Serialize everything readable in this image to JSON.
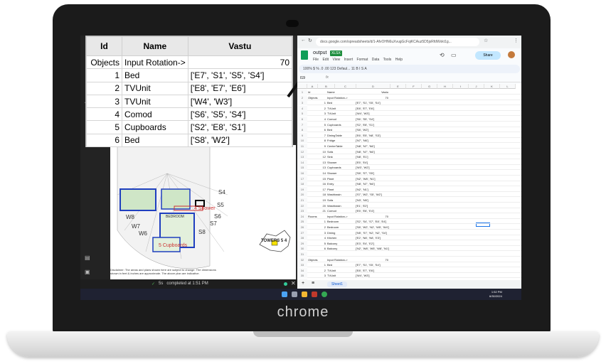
{
  "brand": "chrome",
  "overlay_table": {
    "headers": [
      "Id",
      "Name",
      "Vastu"
    ],
    "first_row": {
      "id": "Objects",
      "name": "Input Rotation->",
      "vastu": "70"
    },
    "rows": [
      {
        "id": "1",
        "name": "Bed",
        "vastu": "['E7', 'S1', 'S5', 'S4']"
      },
      {
        "id": "2",
        "name": "TVUnit",
        "vastu": "['E8', 'E7', 'E6']"
      },
      {
        "id": "3",
        "name": "TVUnit",
        "vastu": "['W4', 'W3']"
      },
      {
        "id": "4",
        "name": "Comod",
        "vastu": "['S6', 'S5', 'S4']"
      },
      {
        "id": "5",
        "name": "Cupboards",
        "vastu": "['S2', 'E8', 'S1']"
      },
      {
        "id": "6",
        "name": "Bed",
        "vastu": "['S8', 'W2']"
      }
    ]
  },
  "drawing": {
    "tower_label": "TOWERS 5 4",
    "disclaimer": "Disclaimer: The areas and plans shown here are subject to change. The dimensions shown in feet & inches are approximate. The above plan are indicative.",
    "labels": [
      "W8",
      "W7",
      "W6",
      "S4",
      "S5",
      "S6",
      "S7",
      "S8",
      "BEDROOM",
      "4 Shower",
      "5 Cupboards"
    ]
  },
  "status_bar": {
    "icon": "check-icon",
    "time": "5s",
    "text": "completed at 1:51 PM"
  },
  "sheets": {
    "url": "docs.google.com/spreadsheets/d/1-AfvOHN6uXvugGcFqiKCAuz5D5jsRfdWxkt1g...",
    "title": "output",
    "badge": "XLSX",
    "menu": [
      "File",
      "Edit",
      "View",
      "Insert",
      "Format",
      "Data",
      "Tools",
      "Help"
    ],
    "share_label": "Share",
    "toolbar_text": "100%   $  %  .0  .00  123   Defaul...   11   B  I  S  A",
    "name_box": "I19",
    "columns": [
      "A",
      "B",
      "C",
      "D",
      "E",
      "F",
      "G",
      "H",
      "I",
      "J",
      "K",
      "L"
    ],
    "rows": [
      {
        "n": "1",
        "a": "Id",
        "c": "Name",
        "e": "Vastu"
      },
      {
        "n": "2",
        "a": "Objects",
        "c": "Input Rotation->",
        "e": "70"
      },
      {
        "n": "3",
        "b": "1",
        "c": "Bed",
        "d": "['E7', 'S1', 'S5', 'S4']"
      },
      {
        "n": "4",
        "b": "2",
        "c": "TVUnit",
        "d": "['E8', 'E7', 'E6']"
      },
      {
        "n": "5",
        "b": "3",
        "c": "TVUnit",
        "d": "['W4', 'W3']"
      },
      {
        "n": "6",
        "b": "4",
        "c": "Comod",
        "d": "['S6', 'S5', 'S4']"
      },
      {
        "n": "7",
        "b": "5",
        "c": "Cupboards",
        "d": "['S2', 'E8', 'S1']"
      },
      {
        "n": "8",
        "b": "6",
        "c": "Bed",
        "d": "['S8', 'W2']"
      },
      {
        "n": "9",
        "b": "7",
        "c": "DiningTable",
        "d": "['E6', 'E5', 'N8', 'S3']"
      },
      {
        "n": "10",
        "b": "8",
        "c": "Fridge",
        "d": "['N7', 'N6']"
      },
      {
        "n": "11",
        "b": "9",
        "c": "CenterTable",
        "d": "['N8', 'N7', 'N6']"
      },
      {
        "n": "12",
        "b": "10",
        "c": "Sofa",
        "d": "['N8', 'N7', 'N6']"
      },
      {
        "n": "13",
        "b": "12",
        "c": "Sink",
        "d": "['N8', 'E1']"
      },
      {
        "n": "14",
        "b": "13",
        "c": "Shower",
        "d": "['E5', 'E4']"
      },
      {
        "n": "15",
        "b": "13",
        "c": "Cupboards",
        "d": "['W3', 'W2']"
      },
      {
        "n": "16",
        "b": "14",
        "c": "Shower",
        "d": "['S8', 'S7', 'S5']"
      },
      {
        "n": "17",
        "b": "15",
        "c": "Plant",
        "d": "['N2', 'W8', 'N1']"
      },
      {
        "n": "18",
        "b": "16",
        "c": "Entry",
        "d": "['N8', 'N7', 'N6']"
      },
      {
        "n": "19",
        "b": "17",
        "c": "Plant",
        "d": "['N2', 'N1']"
      },
      {
        "n": "20",
        "b": "18",
        "c": "Washbasin",
        "d": "['S7', 'W2', 'S5', 'W2']"
      },
      {
        "n": "21",
        "b": "19",
        "c": "Sofa",
        "d": "['N3', 'N5']"
      },
      {
        "n": "22",
        "b": "20",
        "c": "Washbasin",
        "d": "['E1', 'E2']"
      },
      {
        "n": "23",
        "b": "21",
        "c": "Comod",
        "d": "['E5', 'E6', 'E4']"
      },
      {
        "n": "24",
        "a": "Rooms",
        "c": "Input Rotation->",
        "e": "70"
      },
      {
        "n": "25",
        "b": "1",
        "c": "Bedroom",
        "d": "['S2', 'S4', 'S7', 'E8', 'E4']"
      },
      {
        "n": "26",
        "b": "2",
        "c": "Bedroom",
        "d": "['S8', 'W2', 'N2', 'W5', 'W4']"
      },
      {
        "n": "27",
        "b": "3",
        "c": "Dining",
        "d": "['N5', 'S7', 'N2', 'N2', 'S4']"
      },
      {
        "n": "28",
        "b": "4",
        "c": "Kitchen",
        "d": "['E2', 'N8', 'N8', 'E3']"
      },
      {
        "n": "29",
        "b": "5",
        "c": "Balcony",
        "d": "['E3', 'E4', 'E2']"
      },
      {
        "n": "30",
        "b": "6",
        "c": "Balcony",
        "d": "['N2', 'W8', 'W5', 'W8', 'N1']"
      },
      {
        "n": "31",
        "a": "",
        "c": "",
        "d": ""
      },
      {
        "n": "32",
        "a": "Objects",
        "c": "Input Rotation->",
        "e": "70"
      },
      {
        "n": "33",
        "b": "1",
        "c": "Bed",
        "d": "['E7', 'S1', 'S5', 'S4']"
      },
      {
        "n": "34",
        "b": "2",
        "c": "TVUnit",
        "d": "['E8', 'E7', 'E6']"
      },
      {
        "n": "35",
        "b": "3",
        "c": "TVUnit",
        "d": "['W4', 'W3']"
      },
      {
        "n": "36",
        "b": "4",
        "c": "Comod",
        "d": "['S6', 'S5', 'S4']"
      }
    ],
    "sheet_tab": "Sheet1"
  },
  "taskbar": {
    "time": "1:52 PM",
    "date": "6/30/2024"
  },
  "colors": {
    "accent": "#1a73e8",
    "sheets_green": "#0f9d58",
    "taskbar": "#1f2232"
  }
}
